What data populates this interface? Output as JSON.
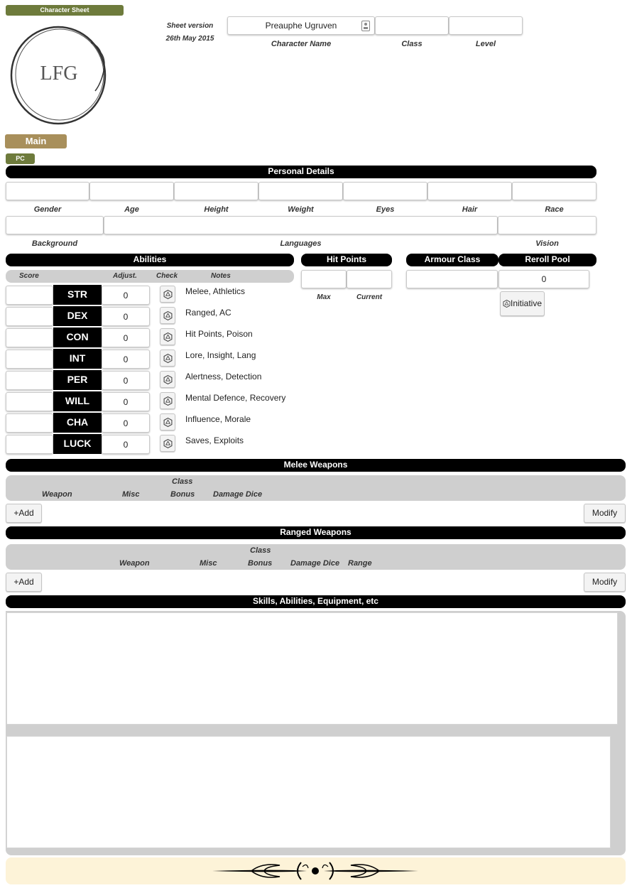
{
  "header": {
    "sheet_tag": "Character Sheet",
    "logo_text": "LFG",
    "sheet_version_label": "Sheet version",
    "sheet_version_date": "26th May 2015",
    "character_name": "Preauphe Ugruven",
    "class_value": "",
    "level_value": "",
    "labels": {
      "name": "Character Name",
      "class": "Class",
      "level": "Level"
    }
  },
  "tabs": {
    "main": "Main",
    "pc": "PC"
  },
  "personal": {
    "title": "Personal Details",
    "row1_labels": [
      "Gender",
      "Age",
      "Height",
      "Weight",
      "Eyes",
      "Hair",
      "Race"
    ],
    "row2_labels": {
      "background": "Background",
      "languages": "Languages",
      "vision": "Vision"
    }
  },
  "abilities": {
    "title": "Abilities",
    "col_headers": {
      "score": "Score",
      "adjust": "Adjust.",
      "check": "Check",
      "notes": "Notes"
    },
    "rows": [
      {
        "name": "STR",
        "adjust": "0",
        "notes": "Melee, Athletics"
      },
      {
        "name": "DEX",
        "adjust": "0",
        "notes": "Ranged, AC"
      },
      {
        "name": "CON",
        "adjust": "0",
        "notes": "Hit Points, Poison"
      },
      {
        "name": "INT",
        "adjust": "0",
        "notes": "Lore, Insight, Lang"
      },
      {
        "name": "PER",
        "adjust": "0",
        "notes": "Alertness, Detection"
      },
      {
        "name": "WILL",
        "adjust": "0",
        "notes": "Mental Defence, Recovery"
      },
      {
        "name": "CHA",
        "adjust": "0",
        "notes": "Influence, Morale"
      },
      {
        "name": "LUCK",
        "adjust": "0",
        "notes": "Saves, Exploits"
      }
    ]
  },
  "hit_points": {
    "title": "Hit Points",
    "max_label": "Max",
    "current_label": "Current"
  },
  "armour_class": {
    "title": "Armour Class"
  },
  "reroll_pool": {
    "title": "Reroll Pool",
    "value": "0",
    "initiative_label": "Initiative"
  },
  "melee": {
    "title": "Melee Weapons",
    "col_headers": {
      "weapon": "Weapon",
      "misc": "Misc",
      "class": "Class",
      "bonus": "Bonus",
      "damage": "Damage Dice"
    },
    "add_label": "+Add",
    "modify_label": "Modify"
  },
  "ranged": {
    "title": "Ranged Weapons",
    "col_headers": {
      "weapon": "Weapon",
      "misc": "Misc",
      "class": "Class",
      "bonus": "Bonus",
      "damage": "Damage Dice",
      "range": "Range"
    },
    "add_label": "+Add",
    "modify_label": "Modify"
  },
  "skills": {
    "title": "Skills, Abilities, Equipment, etc"
  },
  "colors": {
    "green_tag": "#6e7b3c",
    "gold_tab": "#a88f5b",
    "footer_bg": "#fdf3d8",
    "header_bar": "#000000"
  }
}
